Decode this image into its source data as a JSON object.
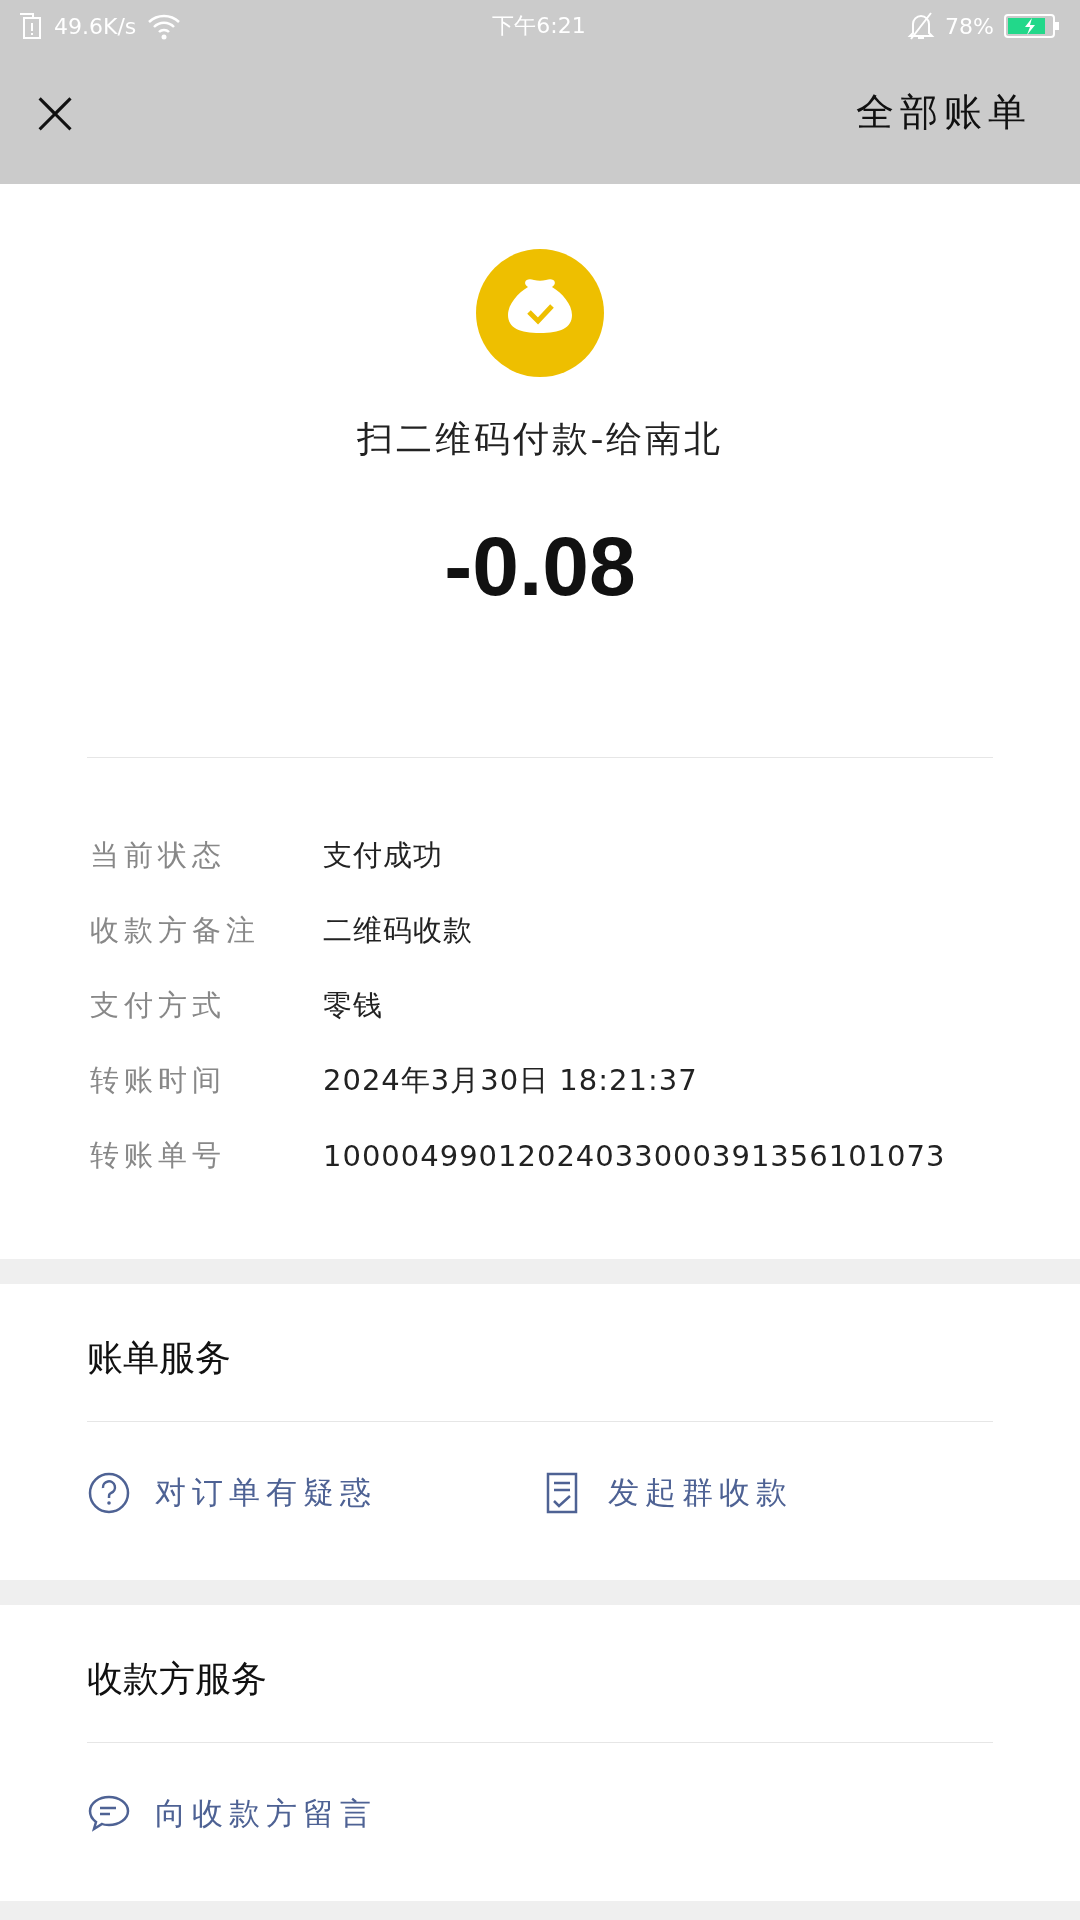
{
  "status_bar": {
    "network_speed": "49.6K/s",
    "time": "下午6:21",
    "battery": "78%"
  },
  "header": {
    "close": "×",
    "title": "全部账单"
  },
  "summary": {
    "title": "扫二维码付款-给南北",
    "amount": "-0.08"
  },
  "details": [
    {
      "label": "当前状态",
      "value": "支付成功"
    },
    {
      "label": "收款方备注",
      "value": "二维码收款"
    },
    {
      "label": "支付方式",
      "value": "零钱"
    },
    {
      "label": "转账时间",
      "value": "2024年3月30日 18:21:37"
    },
    {
      "label": "转账单号",
      "value": "10000499012024033000391356101073"
    }
  ],
  "sections": [
    {
      "title": "账单服务",
      "actions": [
        {
          "kind": "question",
          "label": "对订单有疑惑"
        },
        {
          "kind": "checklist",
          "label": "发起群收款"
        }
      ]
    },
    {
      "title": "收款方服务",
      "actions": [
        {
          "kind": "message",
          "label": "向收款方留言"
        }
      ]
    }
  ]
}
